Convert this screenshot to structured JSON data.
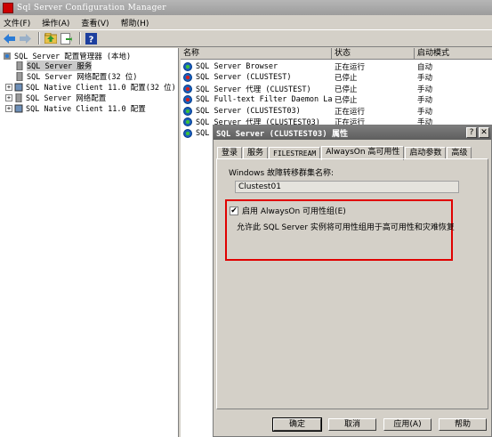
{
  "window": {
    "title": "Sql Server Configuration Manager"
  },
  "menu": [
    "文件(F)",
    "操作(A)",
    "查看(V)",
    "帮助(H)"
  ],
  "toolbar": {
    "buttons": [
      "back-arrow-icon",
      "forward-arrow-icon",
      "up-folder-icon",
      "export-list-icon",
      "help-icon"
    ],
    "help_glyph": "?"
  },
  "tree": {
    "root": "SQL Server 配置管理器 (本地)",
    "items": [
      {
        "label": "SQL Server 服务",
        "expander": ""
      },
      {
        "label": "SQL Server 网络配置(32 位)",
        "expander": ""
      },
      {
        "label": "SQL Native Client 11.0 配置(32 位)",
        "expander": "+"
      },
      {
        "label": "SQL Server 网络配置",
        "expander": "+"
      },
      {
        "label": "SQL Native Client 11.0 配置",
        "expander": "+"
      }
    ]
  },
  "list": {
    "columns": [
      "名称",
      "状态",
      "启动模式"
    ],
    "rows": [
      {
        "name": "SQL Server Browser",
        "status": "正在运行",
        "mode": "自动",
        "running": true
      },
      {
        "name": "SQL Server (CLUSTEST)",
        "status": "已停止",
        "mode": "手动",
        "running": false
      },
      {
        "name": "SQL Server 代理 (CLUSTEST)",
        "status": "已停止",
        "mode": "手动",
        "running": false
      },
      {
        "name": "SQL Full-text Filter Daemon La...",
        "status": "已停止",
        "mode": "手动",
        "running": false
      },
      {
        "name": "SQL Server (CLUSTEST03)",
        "status": "正在运行",
        "mode": "手动",
        "running": true
      },
      {
        "name": "SQL Server 代理 (CLUSTEST03)",
        "status": "正在运行",
        "mode": "手动",
        "running": true
      },
      {
        "name": "SQL",
        "status": "",
        "mode": "",
        "running": true
      }
    ]
  },
  "dialog": {
    "title": "SQL Server (CLUSTEST03) 属性",
    "help_btn": "?",
    "close_btn": "✕",
    "tabs": [
      "登录",
      "服务",
      "FILESTREAM",
      "AlwaysOn 高可用性",
      "启动参数",
      "高级"
    ],
    "active_tab": "AlwaysOn 高可用性",
    "cluster_label": "Windows 故障转移群集名称:",
    "cluster_value": "Clustest01",
    "checkbox_label": "启用 AlwaysOn 可用性组(E)",
    "checkbox_checked": true,
    "checkbox_mark": "✔",
    "description": "允许此 SQL Server 实例将可用性组用于高可用性和灾难恢复",
    "buttons": {
      "ok": "确定",
      "cancel": "取消",
      "apply": "应用(A)",
      "help": "帮助"
    },
    "highlight_color": "#e00000"
  }
}
